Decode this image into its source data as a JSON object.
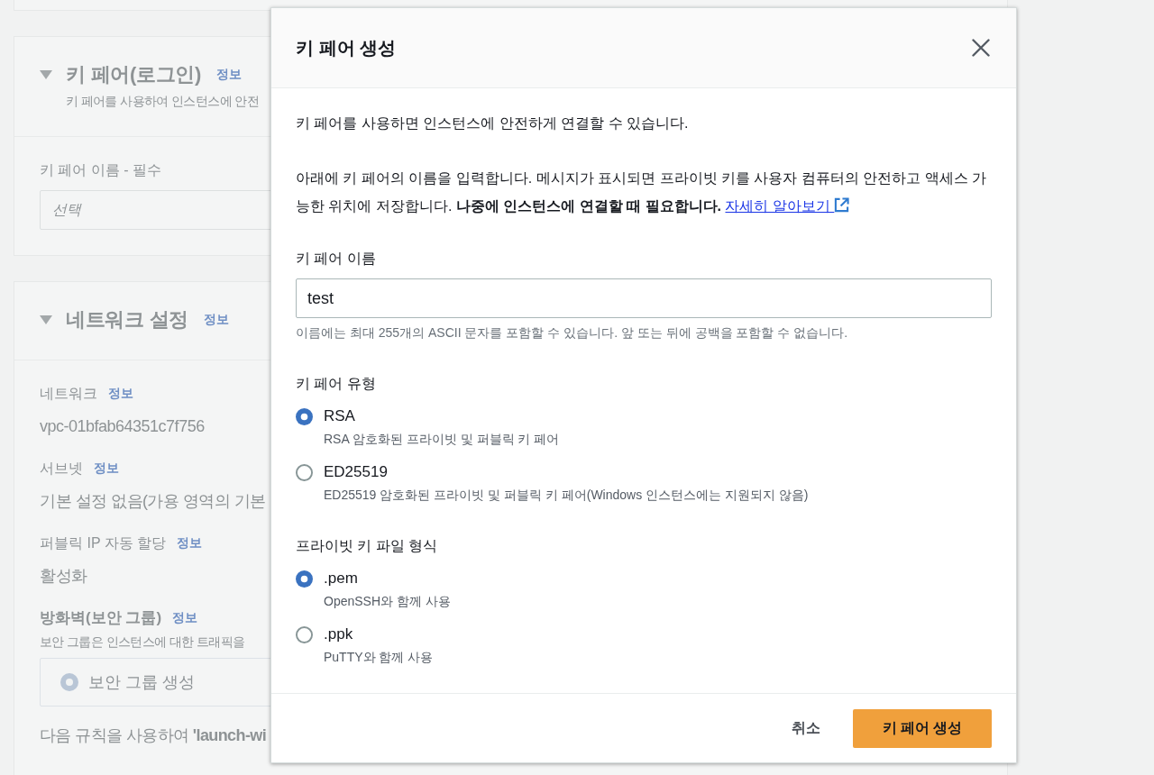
{
  "background_page": {
    "sections": [
      {
        "title": "키 페어(로그인)",
        "info_link": "정보",
        "expanded": true,
        "description": "키 페어를 사용하여 인스턴스에 안전",
        "fields": [
          {
            "kind": "select",
            "label": "키 페어 이름 - 필수",
            "placeholder": "선택"
          }
        ]
      },
      {
        "title": "네트워크 설정",
        "info_link": "정보",
        "expanded": true,
        "fields": [
          {
            "kind": "value",
            "label": "네트워크",
            "info_link": "정보",
            "value": "vpc-01bfab64351c7f756"
          },
          {
            "kind": "value",
            "label": "서브넷",
            "info_link": "정보",
            "value": "기본 설정 없음(가용 영역의 기본"
          },
          {
            "kind": "value",
            "label": "퍼블릭 IP 자동 할당",
            "info_link": "정보",
            "value": "활성화"
          },
          {
            "kind": "choice",
            "label": "방화벽(보안 그룹)",
            "info_link": "정보",
            "description": "보안 그룹은 인스턴스에 대한 트래픽을",
            "options": [
              {
                "label": "보안 그룹 생성",
                "selected": true
              }
            ]
          },
          {
            "kind": "note",
            "text": "다음 규칙을 사용하여 **'launch-wi**"
          }
        ]
      }
    ]
  },
  "dialog": {
    "title": "키 페어 생성",
    "intro": "키 페어를 사용하면 인스턴스에 안전하게 연결할 수 있습니다.",
    "instructions": {
      "text": "아래에 키 페어의 이름을 입력합니다. 메시지가 표시되면 프라이빗 키를 사용자 컴퓨터의 안전하고 액세스 가능한 위치에 저장합니다. **나중에 인스턴스에 연결할 때 필요합니다.**",
      "link": "자세히 알아보기"
    },
    "name_field": {
      "label": "키 페어 이름",
      "value": "test",
      "hint": "이름에는 최대 255개의 ASCII 문자를 포함할 수 있습니다. 앞 또는 뒤에 공백을 포함할 수 없습니다."
    },
    "radio_groups": [
      {
        "label": "키 페어 유형",
        "options": [
          {
            "label": "RSA",
            "description": "RSA 암호화된 프라이빗 및 퍼블릭 키 페어",
            "selected": true
          },
          {
            "label": "ED25519",
            "description": "ED25519 암호화된 프라이빗 및 퍼블릭 키 페어(Windows 인스턴스에는 지원되지 않음)",
            "selected": false
          }
        ]
      },
      {
        "label": "프라이빗 키 파일 형식",
        "options": [
          {
            "label": ".pem",
            "description": "OpenSSH와 함께 사용",
            "selected": true
          },
          {
            "label": ".ppk",
            "description": "PuTTY와 함께 사용",
            "selected": false
          }
        ]
      }
    ],
    "buttons": [
      {
        "label": "취소",
        "kind": "cancel"
      },
      {
        "label": "키 페어 생성",
        "kind": "primary"
      }
    ]
  }
}
